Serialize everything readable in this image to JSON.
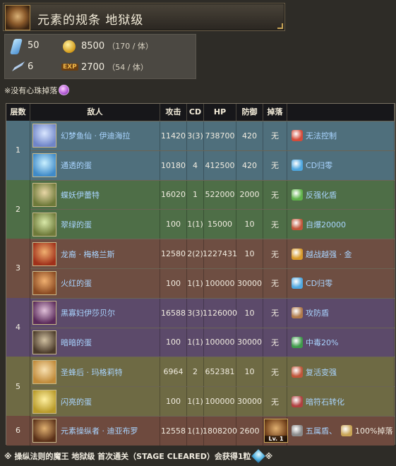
{
  "header": {
    "title": "元素的规条 地狱级"
  },
  "stats": {
    "stamina": "50",
    "coin": "8500",
    "coin_unit": "（170 / 体）",
    "stone": "6",
    "exp_label": "EXP",
    "exp": "2700",
    "exp_unit": "（54 / 体）"
  },
  "note": "※没有心珠掉落",
  "table": {
    "headers": [
      "层数",
      "敌人",
      "攻击",
      "CD",
      "HP",
      "防御",
      "掉落",
      ""
    ],
    "floors": [
      {
        "floor": "1",
        "color": "#4f6f7c",
        "rows": [
          {
            "name": "幻梦鱼仙 · 伊迪海拉",
            "attack": "11420",
            "cd": "3(3)",
            "hp": "738700",
            "def": "420",
            "drop": "无",
            "skill": "无法控制",
            "portrait": [
              "#d9e6ff",
              "#6f85c8"
            ],
            "skill_color": "#d44b3a"
          },
          {
            "name": "通透的蛋",
            "attack": "10180",
            "cd": "4",
            "hp": "412500",
            "def": "420",
            "drop": "无",
            "skill": "CD归零",
            "portrait": [
              "#c9f0ff",
              "#3f8ac8"
            ],
            "skill_color": "#4ea7e0"
          }
        ]
      },
      {
        "floor": "2",
        "color": "#4e6e47",
        "rows": [
          {
            "name": "蝶妖伊蕾特",
            "attack": "16020",
            "cd": "1",
            "hp": "522000",
            "def": "2000",
            "drop": "无",
            "skill": "反强化盾",
            "portrait": [
              "#e8d6a6",
              "#6e7a3a"
            ],
            "skill_color": "#5fb24a"
          },
          {
            "name": "翠绿的蛋",
            "attack": "100",
            "cd": "1(1)",
            "hp": "15000",
            "def": "10",
            "drop": "无",
            "skill": "自爆20000",
            "portrait": [
              "#d8e8a8",
              "#6e7a3a"
            ],
            "skill_color": "#c0553a"
          }
        ]
      },
      {
        "floor": "3",
        "color": "#6e4e42",
        "rows": [
          {
            "name": "龙裔 · 梅格兰斯",
            "attack": "12580",
            "cd": "2(2)",
            "hp": "1227431",
            "def": "10",
            "drop": "无",
            "skill": "越战越强 · 金",
            "portrait": [
              "#f0b070",
              "#a0301a"
            ],
            "skill_color": "#d89a2a"
          },
          {
            "name": "火红的蛋",
            "attack": "100",
            "cd": "1(1)",
            "hp": "100000",
            "def": "30000",
            "drop": "无",
            "skill": "CD归零",
            "portrait": [
              "#f0b070",
              "#8a4a22"
            ],
            "skill_color": "#4ea7e0"
          }
        ]
      },
      {
        "floor": "4",
        "color": "#5c4a6a",
        "rows": [
          {
            "name": "黑寡妇伊莎贝尔",
            "attack": "16588",
            "cd": "3(3)",
            "hp": "1126000",
            "def": "10",
            "drop": "无",
            "skill": "攻防盾",
            "portrait": [
              "#e0c0d8",
              "#5a2a5a"
            ],
            "skill_color": "#b07a4a"
          },
          {
            "name": "暗暗的蛋",
            "attack": "100",
            "cd": "1(1)",
            "hp": "100000",
            "def": "30000",
            "drop": "无",
            "skill": "中毒20%",
            "portrait": [
              "#d0c0a0",
              "#4a3a2a"
            ],
            "skill_color": "#3f9a4a"
          }
        ]
      },
      {
        "floor": "5",
        "color": "#6e6a44",
        "rows": [
          {
            "name": "圣蜂后 · 玛格莉特",
            "attack": "6964",
            "cd": "2",
            "hp": "652381",
            "def": "10",
            "drop": "无",
            "skill": "复活变强",
            "portrait": [
              "#f8e0b0",
              "#c08a3a"
            ],
            "skill_color": "#c0553a"
          },
          {
            "name": "闪亮的蛋",
            "attack": "100",
            "cd": "1(1)",
            "hp": "100000",
            "def": "30000",
            "drop": "无",
            "skill": "暗符石转化",
            "portrait": [
              "#fff0a0",
              "#b89a2a"
            ],
            "skill_color": "#b04040"
          }
        ]
      },
      {
        "floor": "6",
        "color": "#6e4a3e",
        "rows": [
          {
            "name": "元素操纵者 · 迪亚布罗",
            "attack": "12558",
            "cd": "1(1)",
            "hp": "1808200",
            "def": "2600",
            "drop": "Lv. 1",
            "skill": "五属盾、",
            "skill_extra": "100%掉落",
            "portrait": [
              "#e0b070",
              "#5a3018"
            ],
            "skill_color": "#8a8a8a"
          }
        ]
      }
    ]
  },
  "footer": {
    "text_before": "※ 操纵法则的魔王 地狱级 首次通关（STAGE CLEARED）会获得1粒",
    "text_after": "※"
  }
}
